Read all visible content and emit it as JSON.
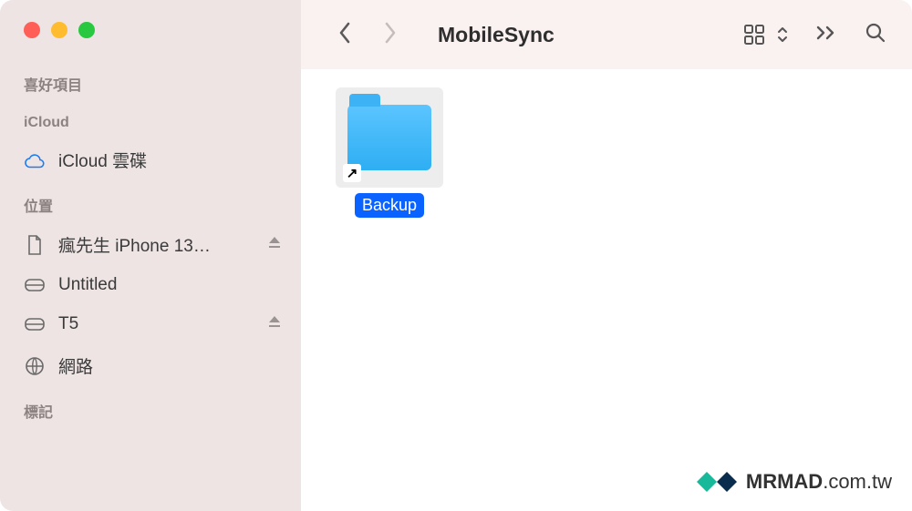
{
  "window": {
    "title": "MobileSync"
  },
  "sidebar": {
    "sections": {
      "favorites": {
        "header": "喜好項目"
      },
      "icloud": {
        "header": "iCloud",
        "items": [
          {
            "label": "iCloud 雲碟",
            "icon": "cloud"
          }
        ]
      },
      "locations": {
        "header": "位置",
        "items": [
          {
            "label": "瘋先生 iPhone 13…",
            "icon": "doc",
            "ejectable": true
          },
          {
            "label": "Untitled",
            "icon": "drive",
            "ejectable": false
          },
          {
            "label": "T5",
            "icon": "drive",
            "ejectable": true
          },
          {
            "label": "網路",
            "icon": "globe",
            "ejectable": false
          }
        ]
      },
      "tags": {
        "header": "標記"
      }
    }
  },
  "content": {
    "items": [
      {
        "name": "Backup",
        "selected": true,
        "type": "folder-alias"
      }
    ]
  },
  "watermark": {
    "brand": "MRMAD",
    "domain": ".com.tw"
  }
}
